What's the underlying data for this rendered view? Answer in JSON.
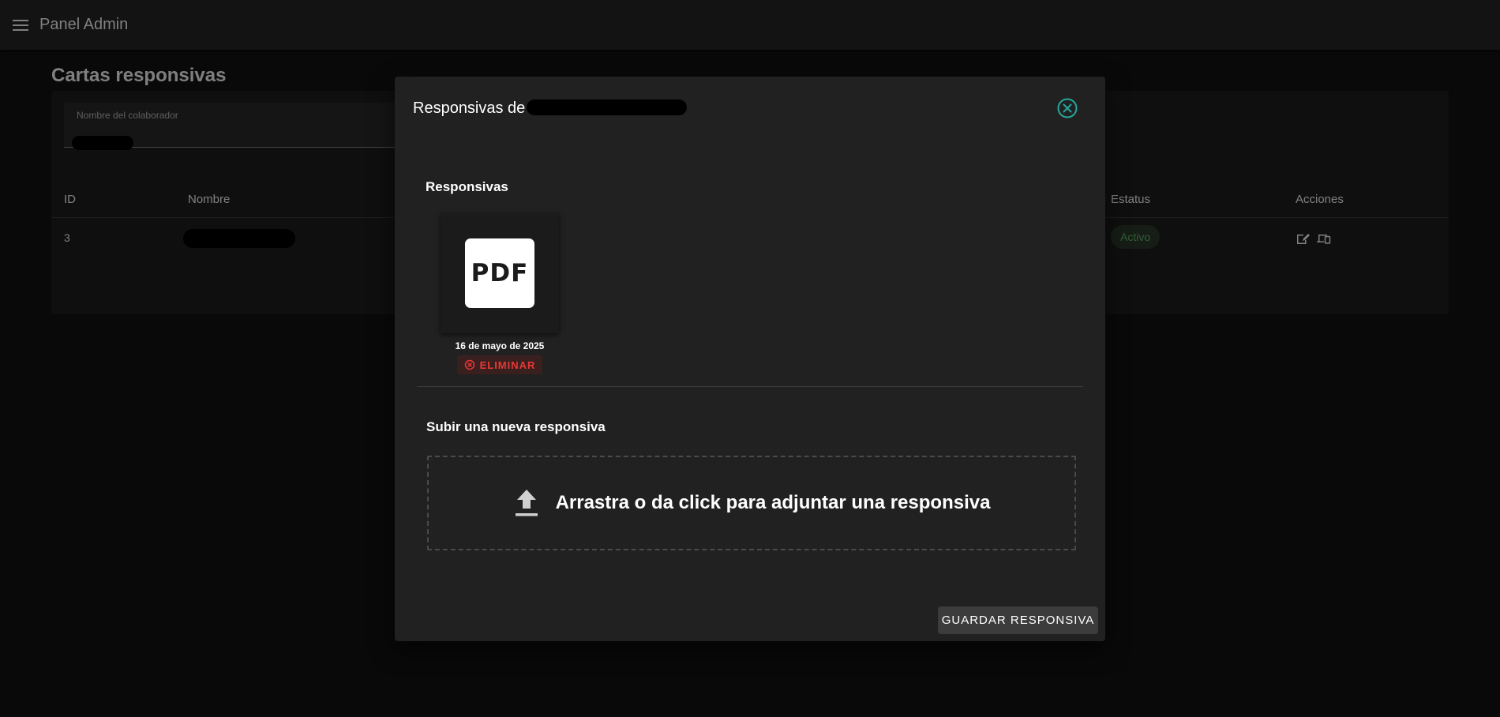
{
  "app": {
    "title": "Panel Admin"
  },
  "page": {
    "title": "Cartas responsivas"
  },
  "filter": {
    "label": "Nombre del colaborador",
    "value": "███"
  },
  "table": {
    "headers": {
      "id": "ID",
      "name": "Nombre",
      "status": "Estatus",
      "actions": "Acciones"
    },
    "rows": [
      {
        "id": "3",
        "name": "████████",
        "status": "Activo"
      }
    ]
  },
  "modal": {
    "title": "Responsivas de",
    "title_redacted": "████████████",
    "section_files": "Responsivas",
    "files": [
      {
        "type_label": "PDF",
        "date": "16 de mayo de 2025",
        "delete_label": "ELIMINAR"
      }
    ],
    "section_upload": "Subir una nueva responsiva",
    "dropzone_text": "Arrastra o da click para adjuntar una responsiva",
    "save_label": "GUARDAR RESPONSIVA"
  },
  "colors": {
    "background": "#121212",
    "appbar": "#272727",
    "modal": "#212121",
    "status_active": "#66bb6a",
    "danger": "#e53935",
    "accent_close": "#26a69a"
  },
  "icons": [
    "menu-icon",
    "edit-icon",
    "devices-icon",
    "close-circle-icon",
    "delete-circle-icon",
    "upload-icon"
  ]
}
